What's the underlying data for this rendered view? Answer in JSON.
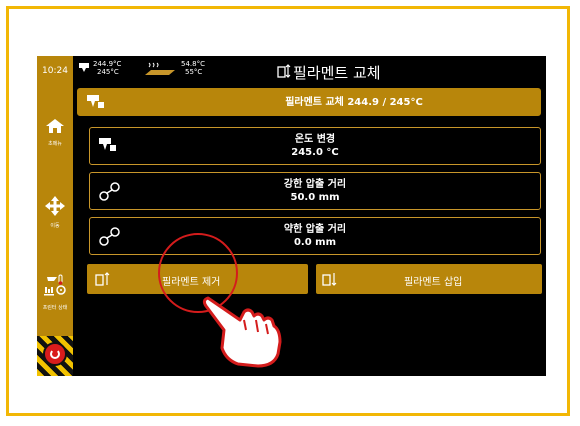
{
  "status": {
    "time": "10:24",
    "nozzle_current": "244.9°C",
    "nozzle_target": "245°C",
    "bed_current": "54.8°C",
    "bed_target": "55°C"
  },
  "header": {
    "title": "필라멘트 교체"
  },
  "sidebar": [
    {
      "label": "초메뉴",
      "icon": "home-icon"
    },
    {
      "label": "이동",
      "icon": "move-icon"
    },
    {
      "label": "프린터 상태",
      "icon": "status-icon"
    }
  ],
  "rows": {
    "active_title": "필라멘트 교체 244.9 / 245°C",
    "temp_title": "온도 변경",
    "temp_value": "245.0 °C",
    "strong_title": "강한 압출 거리",
    "strong_value": "50.0 mm",
    "weak_title": "약한 압출 거리",
    "weak_value": "0.0 mm"
  },
  "actions": {
    "remove": "필라멘트 제거",
    "insert": "필라멘트 삽입"
  },
  "colors": {
    "gold": "#b8860b",
    "frame": "#f2b705",
    "ring": "#d41c1c"
  }
}
